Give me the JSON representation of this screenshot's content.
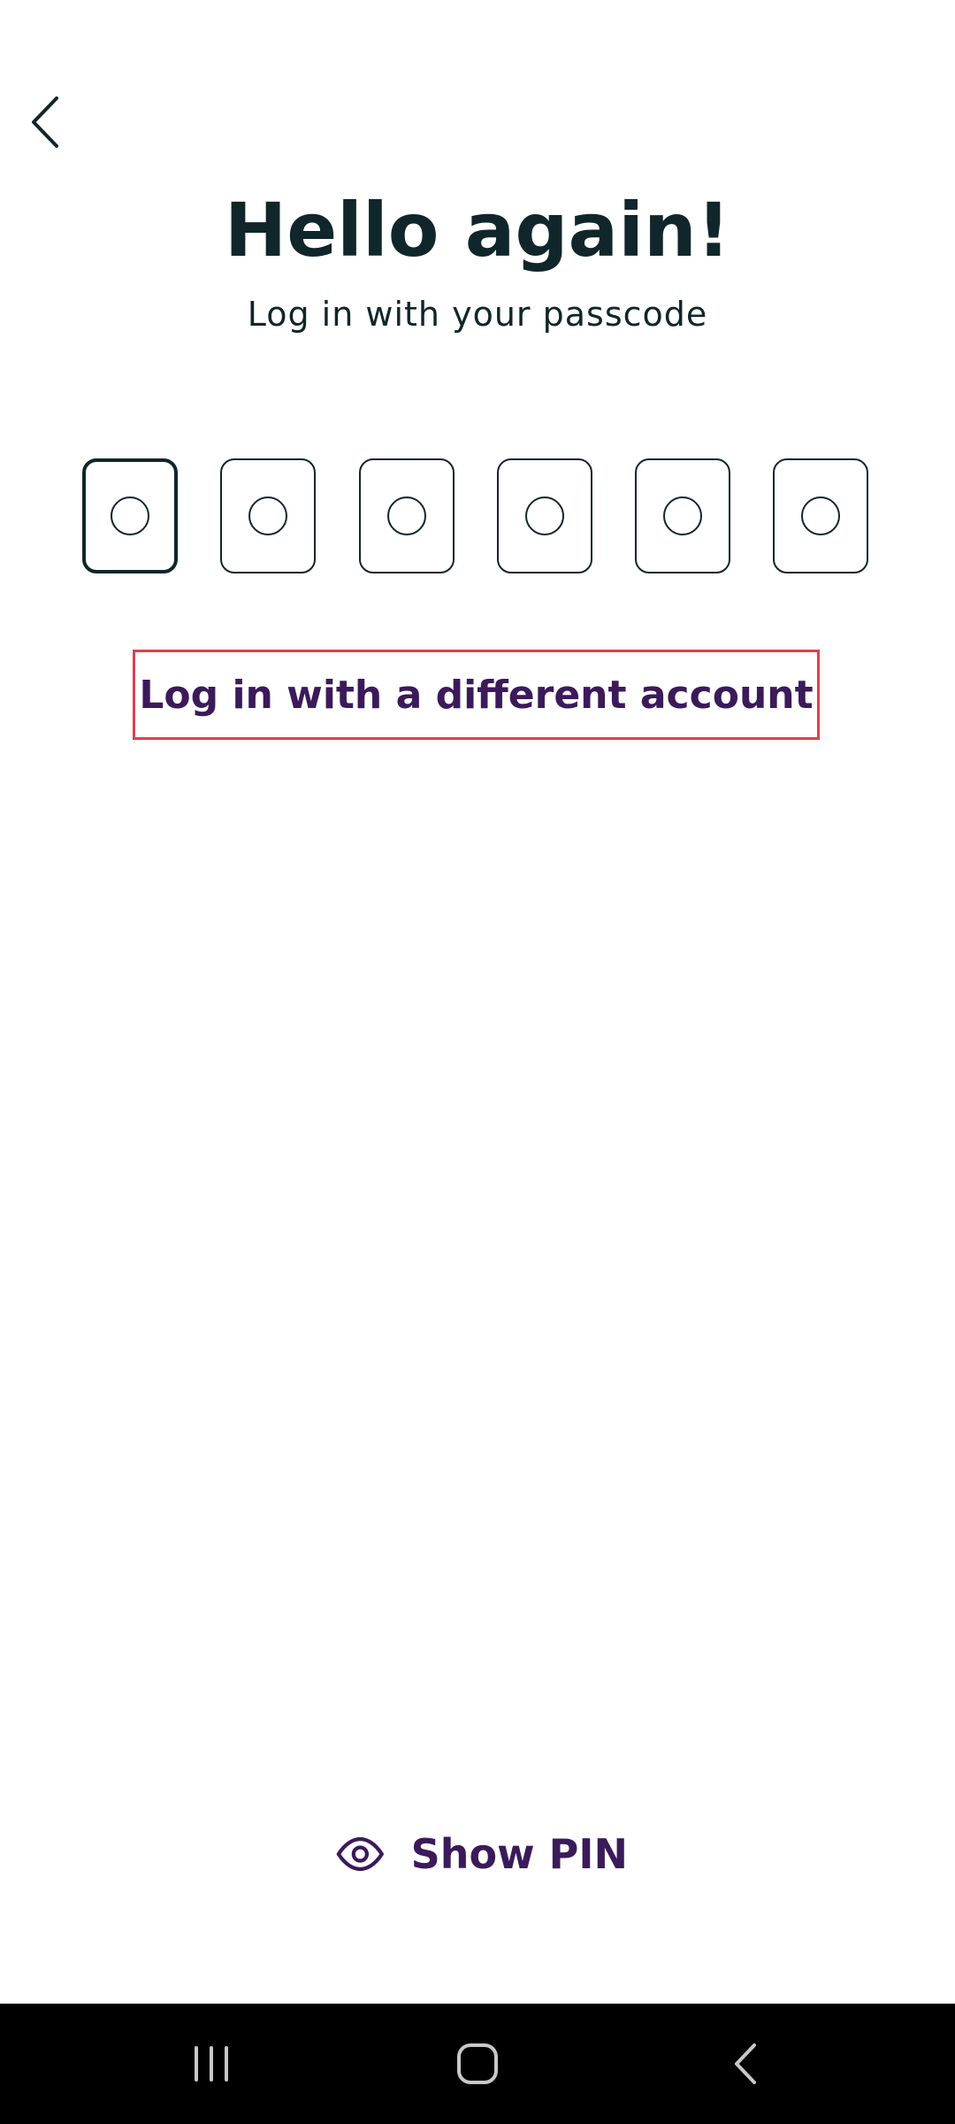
{
  "header": {
    "back_icon": "chevron-left-icon",
    "title": "Hello again!",
    "subtitle": "Log in with your passcode"
  },
  "pin": {
    "length": 6,
    "filled": 0,
    "active_index": 0
  },
  "actions": {
    "different_account_label": "Log in with a different account",
    "show_pin_label": "Show PIN",
    "show_pin_icon": "eye-icon"
  },
  "colors": {
    "text": "#10262a",
    "accent": "#3b1a5a",
    "highlight_border": "#d9434b",
    "nav_bar": "#000000"
  },
  "system_nav": {
    "recents_icon": "recents-icon",
    "home_icon": "home-icon",
    "back_icon": "back-icon"
  }
}
